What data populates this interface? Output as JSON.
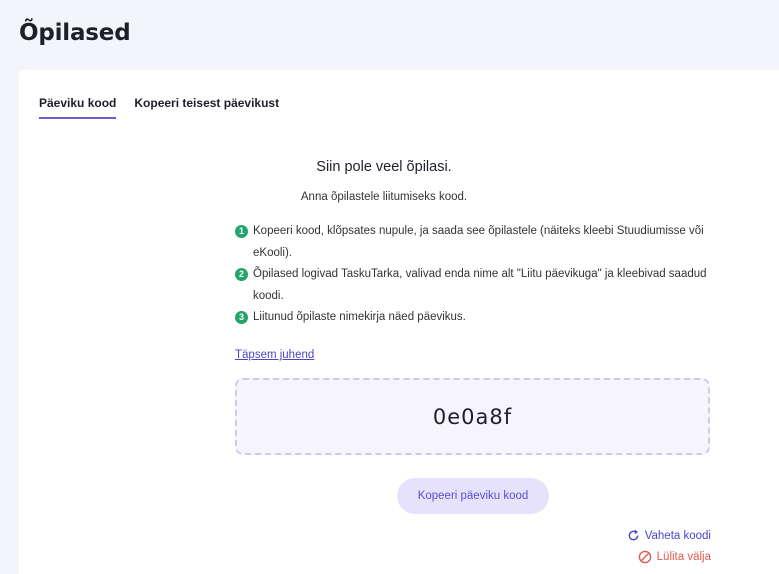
{
  "page": {
    "title": "Õpilased"
  },
  "tabs": [
    {
      "label": "Päeviku kood",
      "active": true
    },
    {
      "label": "Kopeeri teisest päevikust",
      "active": false
    }
  ],
  "empty_state": {
    "title": "Siin pole veel õpilasi.",
    "subtitle": "Anna õpilastele liitumiseks kood."
  },
  "steps": [
    {
      "num": "1",
      "text": "Kopeeri kood, klõpsates nupule, ja saada see õpilastele (näiteks kleebi Stuudiumisse või eKooli)."
    },
    {
      "num": "2",
      "text": "Õpilased logivad TaskuTarka, valivad enda nime alt \"Liitu päevikuga\" ja kleebivad saadud koodi."
    },
    {
      "num": "3",
      "text": "Liitunud õpilaste nimekirja näed päevikus."
    }
  ],
  "guide_link": "Täpsem juhend",
  "code": {
    "value": "0e0a8f"
  },
  "copy_button": "Kopeeri päeviku kood",
  "actions": {
    "change_code": {
      "label": "Vaheta koodi",
      "icon": "refresh-icon"
    },
    "disable": {
      "label": "Lülita välja",
      "icon": "ban-icon"
    }
  },
  "colors": {
    "accent": "#5a4fcf",
    "step_badge": "#22a56b",
    "danger": "#e05a4f",
    "background": "#f4f5fb"
  }
}
